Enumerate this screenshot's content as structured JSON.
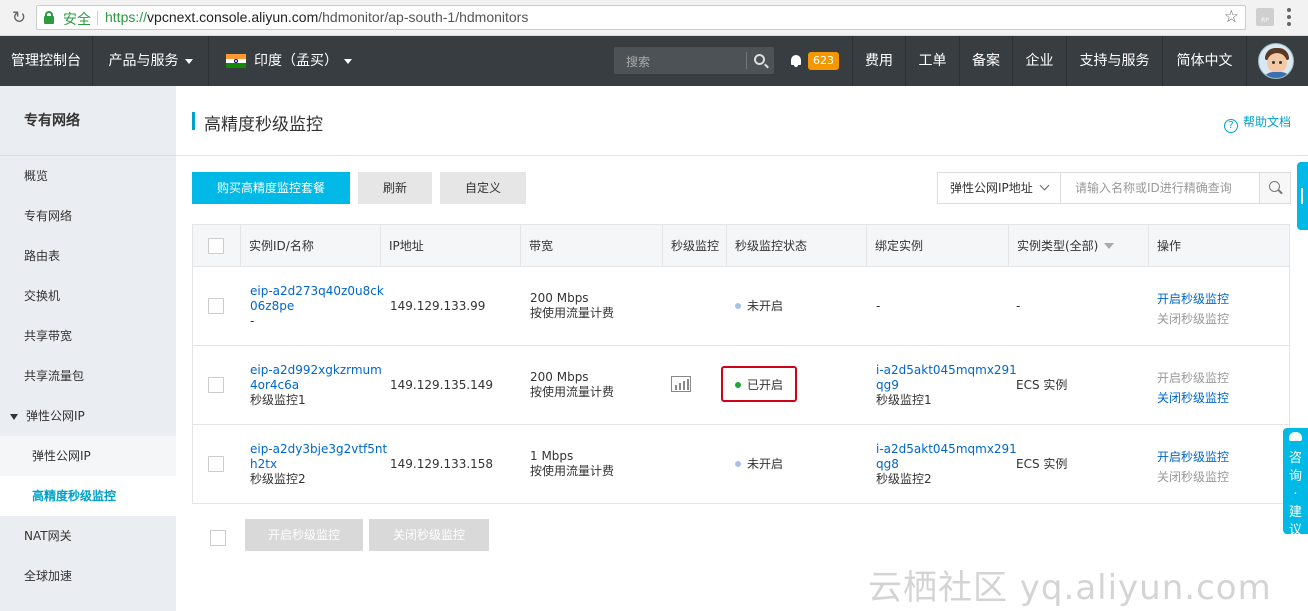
{
  "browser": {
    "secure_label": "安全",
    "url_scheme": "https://",
    "url_host": "vpcnext.console.aliyun.com",
    "url_path": "/hdmonitor/ap-south-1/hdmonitors"
  },
  "topnav": {
    "console": "管理控制台",
    "products": "产品与服务",
    "region": "印度（孟买）",
    "search_placeholder": "搜索",
    "notifications": "623",
    "items": [
      "费用",
      "工单",
      "备案",
      "企业",
      "支持与服务",
      "简体中文"
    ]
  },
  "sidebar": {
    "title": "专有网络",
    "items": [
      "概览",
      "专有网络",
      "路由表",
      "交换机",
      "共享带宽",
      "共享流量包",
      "弹性公网IP",
      "弹性公网IP",
      "高精度秒级监控",
      "NAT网关",
      "全球加速"
    ]
  },
  "page": {
    "title": "高精度秒级监控",
    "help": "帮助文档",
    "buy_button": "购买高精度监控套餐",
    "refresh_button": "刷新",
    "custom_button": "自定义",
    "filter_select": "弹性公网IP地址",
    "filter_placeholder": "请输入名称或ID进行精确查询",
    "enable_button": "开启秒级监控",
    "disable_button": "关闭秒级监控"
  },
  "table": {
    "headers": [
      "实例ID/名称",
      "IP地址",
      "带宽",
      "秒级监控",
      "秒级监控状态",
      "绑定实例",
      "实例类型(全部)",
      "操作"
    ],
    "rows": [
      {
        "id_line1": "eip-a2d273q40z0u8ck",
        "id_line2": "06z8pe",
        "name": "-",
        "ip": "149.129.133.99",
        "bandwidth": "200 Mbps",
        "billing": "按使用流量计费",
        "status": "未开启",
        "bound_line1": "-",
        "bound_line2": "",
        "bound_name": "",
        "type": "-",
        "action_enable": "开启秒级监控",
        "action_disable": "关闭秒级监控"
      },
      {
        "id_line1": "eip-a2d992xgkzrmum",
        "id_line2": "4or4c6a",
        "name": "秒级监控1",
        "ip": "149.129.135.149",
        "bandwidth": "200 Mbps",
        "billing": "按使用流量计费",
        "status": "已开启",
        "bound_line1": "i-a2d5akt045mqmx291",
        "bound_line2": "qg9",
        "bound_name": "秒级监控1",
        "type": "ECS 实例",
        "action_enable": "开启秒级监控",
        "action_disable": "关闭秒级监控"
      },
      {
        "id_line1": "eip-a2dy3bje3g2vtf5nt",
        "id_line2": "h2tx",
        "name": "秒级监控2",
        "ip": "149.129.133.158",
        "bandwidth": "1 Mbps",
        "billing": "按使用流量计费",
        "status": "未开启",
        "bound_line1": "i-a2d5akt045mqmx291",
        "bound_line2": "qg8",
        "bound_name": "秒级监控2",
        "type": "ECS 实例",
        "action_enable": "开启秒级监控",
        "action_disable": "关闭秒级监控"
      }
    ]
  },
  "float": {
    "consult_1": "咨",
    "consult_2": "询",
    "consult_3": "·",
    "consult_4": "建",
    "consult_5": "议"
  },
  "watermark": "云栖社区 yq.aliyun.com",
  "colors": {
    "accent": "#00b9e6",
    "link": "#0066cc",
    "nav_bg": "#373d41",
    "status_on": "#1ea739",
    "status_off": "#aac1e6",
    "highlight": "#d0021b"
  }
}
